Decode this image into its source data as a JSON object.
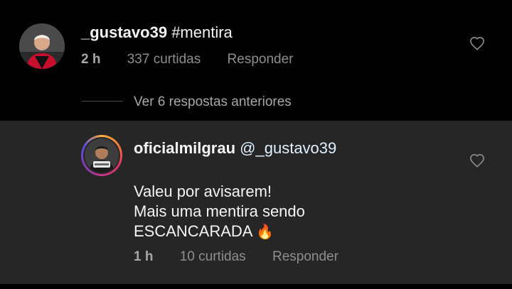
{
  "comment": {
    "username": "_gustavo39",
    "text": "#mentira",
    "time": "2 h",
    "likes": "337 curtidas",
    "reply_label": "Responder"
  },
  "replies_toggle": "Ver 6 respostas anteriores",
  "reply": {
    "username": "oficialmilgrau",
    "mention": "@_gustavo39",
    "line1": "Valeu por avisarem!",
    "line2": "Mais uma mentira sendo",
    "line3": "ESCANCARADA",
    "emoji": "🔥",
    "time": "1 h",
    "likes": "10 curtidas",
    "reply_label": "Responder"
  },
  "colors": {
    "background": "#000000",
    "highlight": "#262626",
    "muted_text": "#8e8e8e",
    "primary_text": "#f5f5f5"
  },
  "icons": {
    "like": "heart-outline-icon",
    "fire": "fire-emoji"
  }
}
